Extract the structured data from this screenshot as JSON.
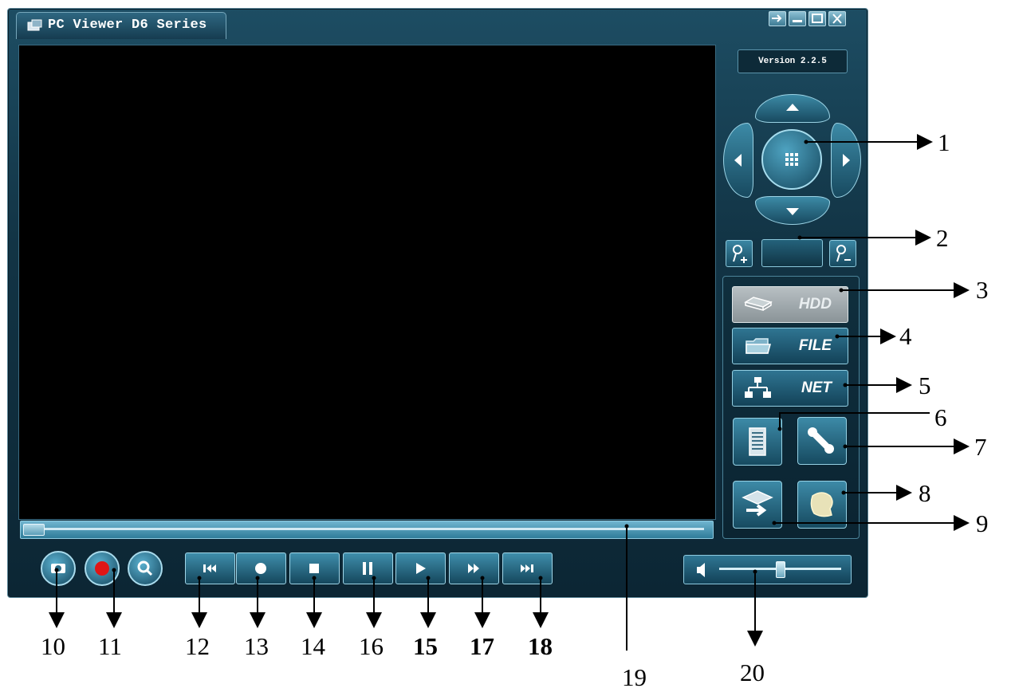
{
  "window": {
    "title": "PC Viewer D6 Series",
    "version": "Version 2.2.5",
    "controls": [
      "pin-icon",
      "minimize-icon",
      "maximize-icon",
      "close-icon"
    ]
  },
  "side_buttons": {
    "hdd": "HDD",
    "file": "FILE",
    "net": "NET"
  },
  "callouts": {
    "c1": "1",
    "c2": "2",
    "c3": "3",
    "c4": "4",
    "c5": "5",
    "c6": "6",
    "c7": "7",
    "c8": "8",
    "c9": "9",
    "c10": "10",
    "c11": "11",
    "c12": "12",
    "c13": "13",
    "c14": "14",
    "c16": "16",
    "c15": "15",
    "c17": "17",
    "c18": "18",
    "c19": "19",
    "c20": "20"
  },
  "colors": {
    "window_bg": "#123445",
    "video_bg": "#000000",
    "record_red": "#e01515",
    "accent": "#9bd3e5"
  },
  "seek_position": 0.0,
  "volume_level": 0.5
}
